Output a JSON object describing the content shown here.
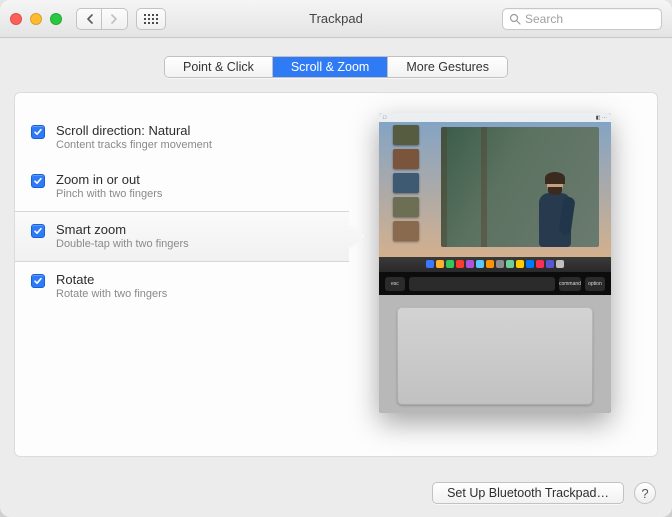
{
  "window": {
    "title": "Trackpad"
  },
  "search": {
    "placeholder": "Search",
    "value": ""
  },
  "tabs": [
    {
      "label": "Point & Click",
      "active": false
    },
    {
      "label": "Scroll & Zoom",
      "active": true
    },
    {
      "label": "More Gestures",
      "active": false
    }
  ],
  "options": [
    {
      "title": "Scroll direction: Natural",
      "desc": "Content tracks finger movement",
      "checked": true,
      "highlighted": false
    },
    {
      "title": "Zoom in or out",
      "desc": "Pinch with two fingers",
      "checked": true,
      "highlighted": false
    },
    {
      "title": "Smart zoom",
      "desc": "Double-tap with two fingers",
      "checked": true,
      "highlighted": true
    },
    {
      "title": "Rotate",
      "desc": "Rotate with two fingers",
      "checked": true,
      "highlighted": false
    }
  ],
  "footer": {
    "setup_button": "Set Up Bluetooth Trackpad…",
    "help_label": "?"
  },
  "icons": {
    "back": "chevron-left",
    "forward": "chevron-right",
    "all_prefs": "grid",
    "search": "magnifying-glass"
  },
  "preview": {
    "touchbar_keys": [
      "esc",
      "",
      "command",
      "option"
    ],
    "dock_colors": [
      "#3b78ff",
      "#ffb02e",
      "#34c759",
      "#ff3b30",
      "#af52de",
      "#5ac8fa",
      "#ff9500",
      "#8e8e93",
      "#6fcf97",
      "#ffcc00",
      "#007aff",
      "#ff2d55",
      "#5856d6",
      "#c0c0c0"
    ]
  }
}
